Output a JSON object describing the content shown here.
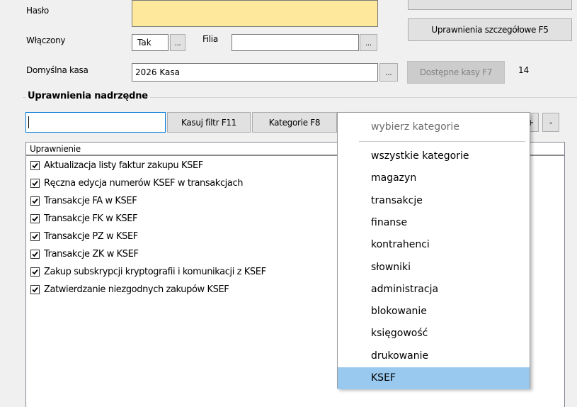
{
  "form": {
    "haslo_label": "Hasło",
    "wlaczony_label": "Włączony",
    "wlaczony_value": "Tak",
    "filia_label": "Filia",
    "filia_value": "",
    "kasa_label": "Domyślna kasa",
    "kasa_value": "2026 Kasa",
    "dots": "...",
    "uprawnienia_szczegolowe_button": "Uprawnienia szczegółowe F5",
    "dostepne_kasy_button": "Dostępne kasy F7",
    "dostepne_kasy_count": "14"
  },
  "group": {
    "title": "Uprawnienia nadrzędne",
    "filter_value": "",
    "kasuj_filtr_button": "Kasuj filtr F11",
    "kategorie_button": "Kategorie F8",
    "plus_button": "+",
    "minus_button": "-",
    "column_header": "Uprawnienie",
    "rows": [
      {
        "label": "Aktualizacja listy faktur zakupu KSEF",
        "checked": true
      },
      {
        "label": "Ręczna edycja numerów KSEF w transakcjach",
        "checked": true
      },
      {
        "label": "Transakcje FA w KSEF",
        "checked": true
      },
      {
        "label": "Transakcje FK w KSEF",
        "checked": true
      },
      {
        "label": "Transakcje PZ w KSEF",
        "checked": true
      },
      {
        "label": "Transakcje ZK w KSEF",
        "checked": true
      },
      {
        "label": "Zakup subskrypcji kryptografii i komunikacji z KSEF",
        "checked": true
      },
      {
        "label": "Zatwierdzanie niezgodnych zakupów KSEF",
        "checked": true
      }
    ]
  },
  "dropdown": {
    "header": "wybierz kategorie",
    "items": [
      {
        "label": "wszystkie kategorie"
      },
      {
        "label": "magazyn"
      },
      {
        "label": "transakcje"
      },
      {
        "label": "finanse"
      },
      {
        "label": "kontrahenci"
      },
      {
        "label": "słowniki"
      },
      {
        "label": "administracja"
      },
      {
        "label": "blokowanie"
      },
      {
        "label": "księgowość"
      },
      {
        "label": "drukowanie"
      },
      {
        "label": "KSEF"
      }
    ],
    "selected": "KSEF"
  },
  "colors": {
    "password_field": "#fde89b",
    "selection": "#99c9ef"
  }
}
